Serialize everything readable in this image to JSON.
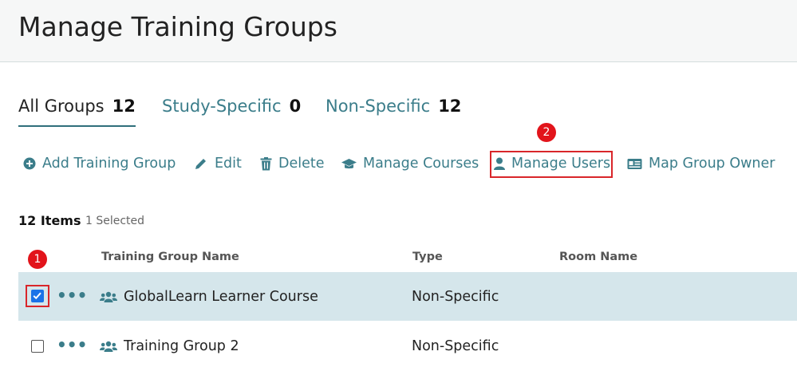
{
  "header": {
    "title": "Manage Training Groups"
  },
  "tabs": [
    {
      "label": "All Groups",
      "count": "12"
    },
    {
      "label": "Study-Specific",
      "count": "0"
    },
    {
      "label": "Non-Specific",
      "count": "12"
    }
  ],
  "toolbar": {
    "add": "Add Training Group",
    "edit": "Edit",
    "delete": "Delete",
    "manage_courses": "Manage Courses",
    "manage_users": "Manage Users",
    "map_owner": "Map Group Owner"
  },
  "list": {
    "items_label": "12 Items",
    "selected_label": "1 Selected",
    "columns": [
      "Training Group Name",
      "Type",
      "Room Name"
    ],
    "rows": [
      {
        "name": "GlobalLearn Learner Course",
        "type": "Non-Specific",
        "room": "",
        "checked": true
      },
      {
        "name": "Training Group 2",
        "type": "Non-Specific",
        "room": "",
        "checked": false
      }
    ],
    "more_icon": "•••"
  },
  "annotations": {
    "step1": "1",
    "step2": "2"
  },
  "colors": {
    "link": "#3b7d8a",
    "selected_row": "#d5e6eb",
    "highlight": "#d9262a"
  }
}
